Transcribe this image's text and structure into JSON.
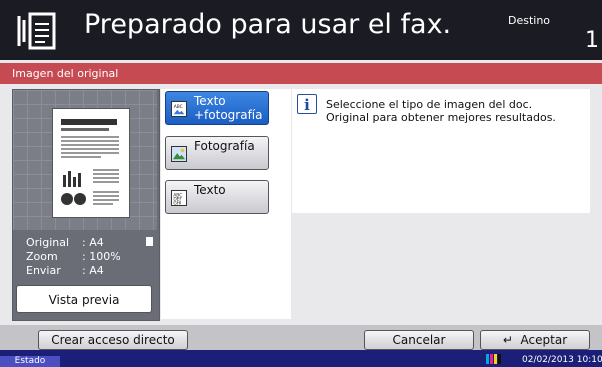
{
  "header": {
    "title": "Preparado para usar el fax.",
    "destination_label": "Destino",
    "destination_count": "1",
    "icon": "fax-document-icon"
  },
  "section": {
    "title": "Imagen del original"
  },
  "preview": {
    "original_label": "Original",
    "original_value": ": A4",
    "zoom_label": "Zoom",
    "zoom_value": ": 100%",
    "send_label": "Enviar",
    "send_value": ": A4",
    "preview_button": "Vista previa"
  },
  "options": [
    {
      "label_line1": "Texto",
      "label_line2": "+fotografía",
      "icon": "text-photo-icon",
      "selected": true
    },
    {
      "label_line1": "Fotografía",
      "label_line2": "",
      "icon": "photo-icon",
      "selected": false
    },
    {
      "label_line1": "Texto",
      "label_line2": "",
      "icon": "text-icon",
      "selected": false
    }
  ],
  "message": {
    "text": "Seleccione el tipo de imagen del doc. Original para obtener mejores resultados."
  },
  "bottom": {
    "shortcut_button": "Crear acceso directo",
    "cancel_button": "Cancelar",
    "accept_button": "Aceptar"
  },
  "status": {
    "label": "Estado",
    "datetime": "02/02/2013 10:10"
  },
  "colors": {
    "header_bg": "#1b1b24",
    "section_bar": "#c64a52",
    "selected_option": "#1b5ec4",
    "status_bar": "#1b1f77"
  }
}
